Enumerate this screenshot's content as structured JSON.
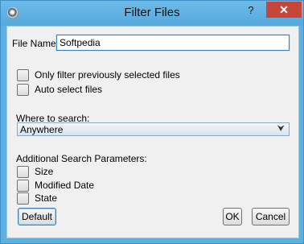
{
  "window": {
    "title": "Filter Files",
    "help_glyph": "?",
    "close_glyph": "✕",
    "app_icon": "gear-app-icon"
  },
  "file_name": {
    "label": "File Name:",
    "value": "Softpedia"
  },
  "options": [
    {
      "label": "Only filter previously selected files",
      "checked": false
    },
    {
      "label": "Auto select files",
      "checked": false
    }
  ],
  "where": {
    "label": "Where to search:",
    "selected": "Anywhere"
  },
  "additional": {
    "label": "Additional Search Parameters:",
    "items": [
      {
        "label": "Size",
        "checked": false
      },
      {
        "label": "Modified Date",
        "checked": false
      },
      {
        "label": "State",
        "checked": false
      }
    ]
  },
  "buttons": {
    "default_label": "Default",
    "ok_label": "OK",
    "cancel_label": "Cancel"
  }
}
